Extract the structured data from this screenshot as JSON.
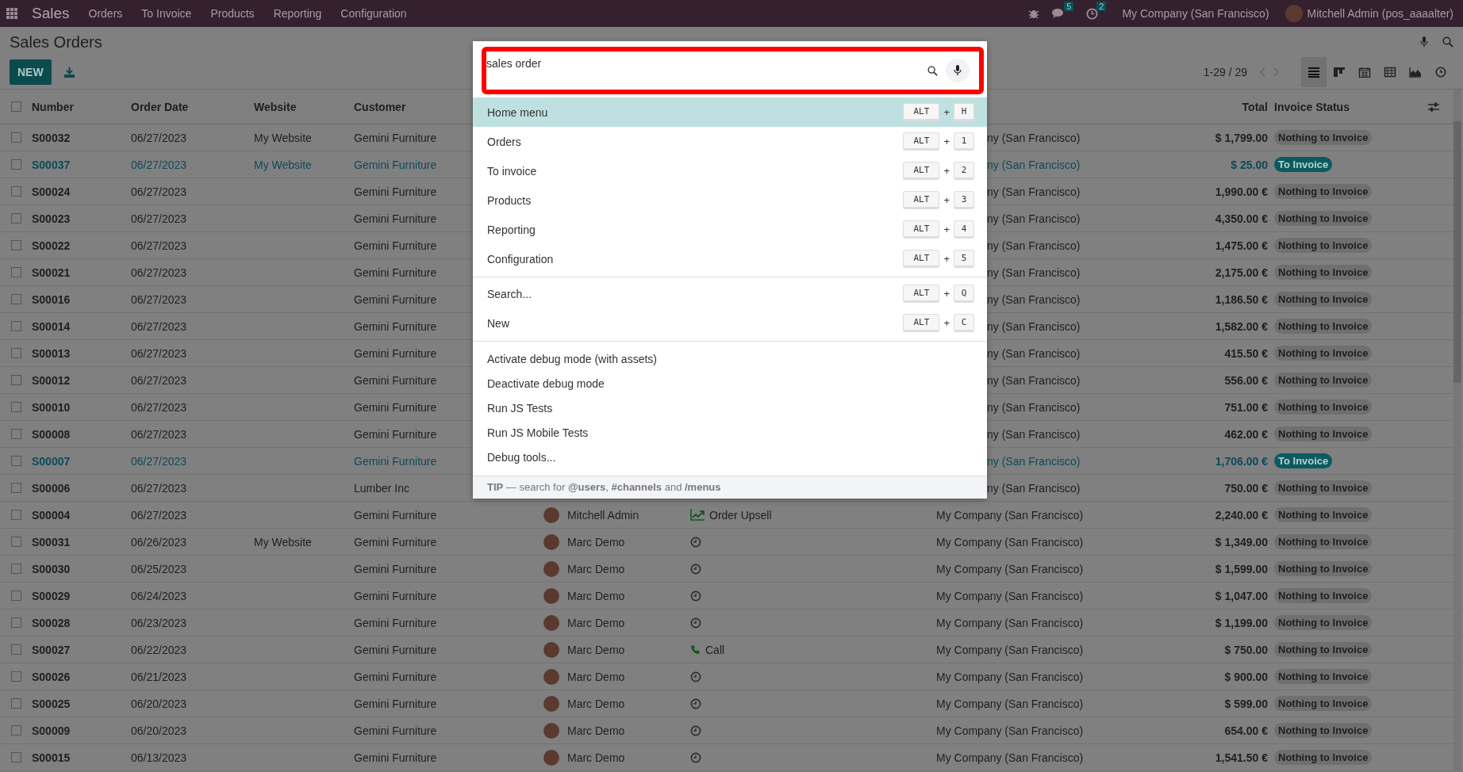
{
  "navbar": {
    "app_name": "Sales",
    "menu": [
      "Orders",
      "To Invoice",
      "Products",
      "Reporting",
      "Configuration"
    ],
    "chat_count": "5",
    "activity_count": "2",
    "company": "My Company (San Francisco)",
    "user": "Mitchell Admin (pos_aaaalter)"
  },
  "control_panel": {
    "title": "Sales Orders",
    "new_button": "NEW",
    "pager": "1-29 / 29",
    "views": [
      {
        "kind": "list",
        "selected": true
      },
      {
        "kind": "kanban",
        "selected": false
      },
      {
        "kind": "calendar",
        "selected": false
      },
      {
        "kind": "pivot",
        "selected": false
      },
      {
        "kind": "graph",
        "selected": false
      },
      {
        "kind": "activity",
        "selected": false
      }
    ]
  },
  "table": {
    "select_all_checked": false,
    "columns": {
      "number": "Number",
      "order_date": "Order Date",
      "website": "Website",
      "customer": "Customer",
      "total": "Total",
      "invoice_status": "Invoice Status"
    },
    "rows": [
      {
        "checked": false,
        "highlighted": false,
        "number": "S00032",
        "date": "06/27/2023",
        "website": "My Website",
        "customer": "Gemini Furniture",
        "company": "ny (San Francisco)",
        "total": "$ 1,799.00",
        "status": "Nothing to Invoice"
      },
      {
        "checked": false,
        "highlighted": true,
        "number": "S00037",
        "date": "06/27/2023",
        "website": "My Website",
        "customer": "Gemini Furniture",
        "company": "ny (San Francisco)",
        "total": "$ 25.00",
        "status": "To Invoice"
      },
      {
        "checked": false,
        "highlighted": false,
        "number": "S00024",
        "date": "06/27/2023",
        "customer": "Gemini Furniture",
        "company": "ny (San Francisco)",
        "total": "1,990.00 €",
        "status": "Nothing to Invoice"
      },
      {
        "checked": false,
        "highlighted": false,
        "number": "S00023",
        "date": "06/27/2023",
        "customer": "Gemini Furniture",
        "company": "ny (San Francisco)",
        "total": "4,350.00 €",
        "status": "Nothing to Invoice"
      },
      {
        "checked": false,
        "highlighted": false,
        "number": "S00022",
        "date": "06/27/2023",
        "customer": "Gemini Furniture",
        "company": "ny (San Francisco)",
        "total": "1,475.00 €",
        "status": "Nothing to Invoice"
      },
      {
        "checked": false,
        "highlighted": false,
        "number": "S00021",
        "date": "06/27/2023",
        "customer": "Gemini Furniture",
        "company": "ny (San Francisco)",
        "total": "2,175.00 €",
        "status": "Nothing to Invoice"
      },
      {
        "checked": false,
        "highlighted": false,
        "number": "S00016",
        "date": "06/27/2023",
        "customer": "Gemini Furniture",
        "company": "ny (San Francisco)",
        "total": "1,186.50 €",
        "status": "Nothing to Invoice"
      },
      {
        "checked": false,
        "highlighted": false,
        "number": "S00014",
        "date": "06/27/2023",
        "customer": "Gemini Furniture",
        "company": "ny (San Francisco)",
        "total": "1,582.00 €",
        "status": "Nothing to Invoice"
      },
      {
        "checked": false,
        "highlighted": false,
        "number": "S00013",
        "date": "06/27/2023",
        "customer": "Gemini Furniture",
        "company": "ny (San Francisco)",
        "total": "415.50 €",
        "status": "Nothing to Invoice"
      },
      {
        "checked": false,
        "highlighted": false,
        "number": "S00012",
        "date": "06/27/2023",
        "customer": "Gemini Furniture",
        "company": "ny (San Francisco)",
        "total": "556.00 €",
        "status": "Nothing to Invoice"
      },
      {
        "checked": false,
        "highlighted": false,
        "number": "S00010",
        "date": "06/27/2023",
        "customer": "Gemini Furniture",
        "company": "ny (San Francisco)",
        "total": "751.00 €",
        "status": "Nothing to Invoice"
      },
      {
        "checked": false,
        "highlighted": false,
        "number": "S00008",
        "date": "06/27/2023",
        "customer": "Gemini Furniture",
        "company": "ny (San Francisco)",
        "total": "462.00 €",
        "status": "Nothing to Invoice"
      },
      {
        "checked": false,
        "highlighted": true,
        "number": "S00007",
        "date": "06/27/2023",
        "customer": "Gemini Furniture",
        "company": "ny (San Francisco)",
        "total": "1,706.00 €",
        "status": "To Invoice"
      },
      {
        "checked": false,
        "highlighted": false,
        "number": "S00006",
        "date": "06/27/2023",
        "customer": "Lumber Inc",
        "company": "ny (San Francisco)",
        "total": "750.00 €",
        "status": "Nothing to Invoice"
      },
      {
        "checked": false,
        "highlighted": false,
        "number": "S00004",
        "date": "06/27/2023",
        "customer": "Gemini Furniture",
        "salesperson": "Mitchell Admin",
        "activity": {
          "kind": "upsell",
          "label": "Order Upsell"
        },
        "company": "My Company (San Francisco)",
        "total": "2,240.00 €",
        "status": "Nothing to Invoice"
      },
      {
        "checked": false,
        "highlighted": false,
        "number": "S00031",
        "date": "06/26/2023",
        "website": "My Website",
        "customer": "Gemini Furniture",
        "salesperson": "Marc Demo",
        "activity": {
          "kind": "none"
        },
        "company": "My Company (San Francisco)",
        "total": "$ 1,349.00",
        "status": "Nothing to Invoice"
      },
      {
        "checked": false,
        "highlighted": false,
        "number": "S00030",
        "date": "06/25/2023",
        "customer": "Gemini Furniture",
        "salesperson": "Marc Demo",
        "activity": {
          "kind": "none"
        },
        "company": "My Company (San Francisco)",
        "total": "$ 1,599.00",
        "status": "Nothing to Invoice"
      },
      {
        "checked": false,
        "highlighted": false,
        "number": "S00029",
        "date": "06/24/2023",
        "customer": "Gemini Furniture",
        "salesperson": "Marc Demo",
        "activity": {
          "kind": "none"
        },
        "company": "My Company (San Francisco)",
        "total": "$ 1,047.00",
        "status": "Nothing to Invoice"
      },
      {
        "checked": false,
        "highlighted": false,
        "number": "S00028",
        "date": "06/23/2023",
        "customer": "Gemini Furniture",
        "salesperson": "Marc Demo",
        "activity": {
          "kind": "none"
        },
        "company": "My Company (San Francisco)",
        "total": "$ 1,199.00",
        "status": "Nothing to Invoice"
      },
      {
        "checked": false,
        "highlighted": false,
        "number": "S00027",
        "date": "06/22/2023",
        "customer": "Gemini Furniture",
        "salesperson": "Marc Demo",
        "activity": {
          "kind": "call",
          "label": "Call"
        },
        "company": "My Company (San Francisco)",
        "total": "$ 750.00",
        "status": "Nothing to Invoice"
      },
      {
        "checked": false,
        "highlighted": false,
        "number": "S00026",
        "date": "06/21/2023",
        "customer": "Gemini Furniture",
        "salesperson": "Marc Demo",
        "activity": {
          "kind": "none"
        },
        "company": "My Company (San Francisco)",
        "total": "$ 900.00",
        "status": "Nothing to Invoice"
      },
      {
        "checked": false,
        "highlighted": false,
        "number": "S00025",
        "date": "06/20/2023",
        "customer": "Gemini Furniture",
        "salesperson": "Marc Demo",
        "activity": {
          "kind": "none"
        },
        "company": "My Company (San Francisco)",
        "total": "$ 599.00",
        "status": "Nothing to Invoice"
      },
      {
        "checked": false,
        "highlighted": false,
        "number": "S00009",
        "date": "06/20/2023",
        "customer": "Gemini Furniture",
        "salesperson": "Marc Demo",
        "activity": {
          "kind": "none"
        },
        "company": "My Company (San Francisco)",
        "total": "654.00 €",
        "status": "Nothing to Invoice"
      },
      {
        "checked": false,
        "highlighted": false,
        "number": "S00015",
        "date": "06/13/2023",
        "customer": "Gemini Furniture",
        "salesperson": "Marc Demo",
        "activity": {
          "kind": "none"
        },
        "company": "My Company (San Francisco)",
        "total": "1,541.50 €",
        "status": "Nothing to Invoice"
      }
    ]
  },
  "command_palette": {
    "query": "sales order",
    "sections": [
      {
        "items": [
          {
            "label": "Home menu",
            "selected": true,
            "shortcut": {
              "modifier": "ALT",
              "joiner": "+",
              "key": "H"
            }
          },
          {
            "label": "Orders",
            "selected": false,
            "shortcut": {
              "modifier": "ALT",
              "joiner": "+",
              "key": "1"
            }
          },
          {
            "label": "To invoice",
            "selected": false,
            "shortcut": {
              "modifier": "ALT",
              "joiner": "+",
              "key": "2"
            }
          },
          {
            "label": "Products",
            "selected": false,
            "shortcut": {
              "modifier": "ALT",
              "joiner": "+",
              "key": "3"
            }
          },
          {
            "label": "Reporting",
            "selected": false,
            "shortcut": {
              "modifier": "ALT",
              "joiner": "+",
              "key": "4"
            }
          },
          {
            "label": "Configuration",
            "selected": false,
            "shortcut": {
              "modifier": "ALT",
              "joiner": "+",
              "key": "5"
            }
          }
        ]
      },
      {
        "items": [
          {
            "label": "Search...",
            "selected": false,
            "shortcut": {
              "modifier": "ALT",
              "joiner": "+",
              "key": "Q"
            }
          },
          {
            "label": "New",
            "selected": false,
            "shortcut": {
              "modifier": "ALT",
              "joiner": "+",
              "key": "C"
            }
          }
        ]
      },
      {
        "items": [
          {
            "label": "Activate debug mode (with assets)",
            "selected": false
          },
          {
            "label": "Deactivate debug mode",
            "selected": false
          },
          {
            "label": "Run JS Tests",
            "selected": false
          },
          {
            "label": "Run JS Mobile Tests",
            "selected": false
          },
          {
            "label": "Debug tools...",
            "selected": false
          }
        ]
      }
    ],
    "tip": "**TIP** — search for **@users**, **#channels** and **/menus**"
  }
}
